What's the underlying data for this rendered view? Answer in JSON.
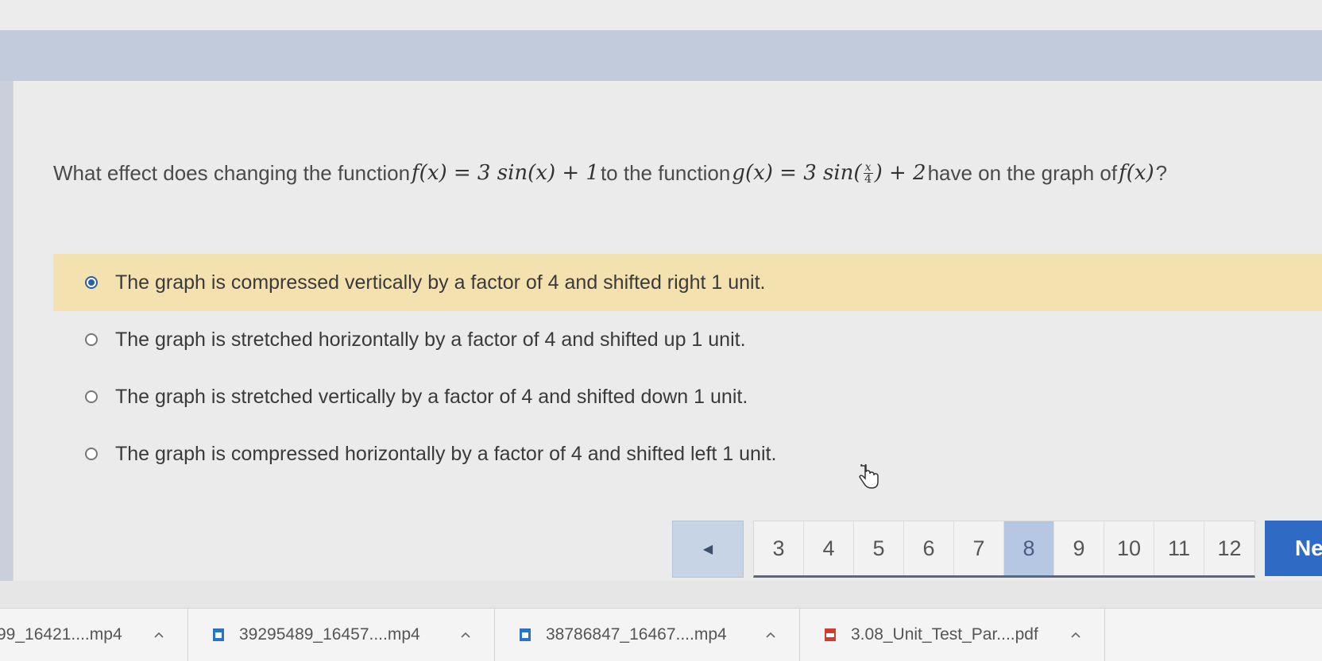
{
  "question": {
    "text_start": "What effect does changing the function ",
    "f_def": "f(x) = 3 sin(x) + 1",
    "text_mid": "to the function ",
    "g_def_prefix": "g(x) = 3 sin(",
    "g_frac_num": "x",
    "g_frac_den": "4",
    "g_def_suffix": ") + 2",
    "text_end": " have on the graph of ",
    "f_ref": "f(x)",
    "question_mark": "?"
  },
  "options": [
    {
      "label": "The graph is compressed vertically by a factor of 4 and shifted right 1 unit.",
      "selected": true
    },
    {
      "label": "The graph is stretched horizontally by a factor of 4 and shifted up 1 unit.",
      "selected": false
    },
    {
      "label": "The graph is stretched vertically by a factor of 4 and shifted down 1 unit.",
      "selected": false
    },
    {
      "label": "The graph is compressed horizontally by a factor of 4 and shifted left 1 unit.",
      "selected": false
    }
  ],
  "pager": {
    "prev_icon": "triangle-left-icon",
    "prev_glyph": "◀",
    "pages": [
      "3",
      "4",
      "5",
      "6",
      "7",
      "8",
      "9",
      "10",
      "11",
      "12"
    ],
    "current": "8",
    "next_label": "Ne"
  },
  "downloads": [
    {
      "name": "99_16421....mp4",
      "icon": "none"
    },
    {
      "name": "39295489_16457....mp4",
      "icon": "file-icon"
    },
    {
      "name": "38786847_16467....mp4",
      "icon": "file-icon"
    },
    {
      "name": "3.08_Unit_Test_Par....pdf",
      "icon": "pdf-icon"
    }
  ],
  "colors": {
    "selected_row": "#f3e1b0",
    "accent_blue": "#2f6bc4",
    "current_page": "#b6c7e3"
  }
}
